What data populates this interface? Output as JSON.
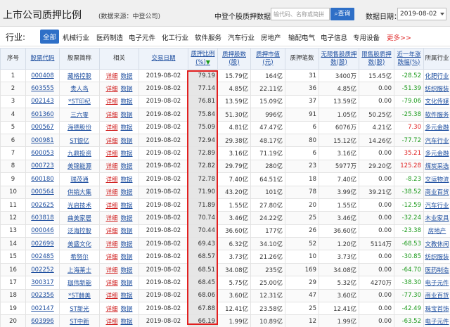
{
  "header": {
    "title": "上市公司质押比例",
    "source": "(数据来源：中登公司)",
    "search_label": "中登个股质押数据：",
    "search_placeholder": "输代码、名称或简拼",
    "search_button": "查询",
    "date_label": "数据日期：",
    "date_value": "2019-08-02"
  },
  "industry": {
    "label": "行业:",
    "items": [
      "全部",
      "机械行业",
      "医药制造",
      "电子元件",
      "化工行业",
      "软件服务",
      "汽车行业",
      "房地产",
      "输配电气",
      "电子信息",
      "专用设备",
      "更多>>"
    ]
  },
  "table": {
    "headers": [
      "序号",
      "股票代码",
      "股票简称",
      "相关",
      "交易日期",
      "质押比例(%)",
      "质押股数(股)",
      "质押市值(元)",
      "质押笔数",
      "无限售股质押数(股)",
      "限售股质押数(股)",
      "近一年涨跌幅(%)",
      "所属行业"
    ],
    "rel_a": "详细",
    "rel_b": "数据",
    "rows": [
      [
        "1",
        "000408",
        "藏格控股",
        "2019-08-02",
        "79.19",
        "15.79亿",
        "164亿",
        "31",
        "3400万",
        "15.45亿",
        "-28.52",
        "化肥行业"
      ],
      [
        "2",
        "603555",
        "贵人鸟",
        "2019-08-02",
        "77.14",
        "4.85亿",
        "22.11亿",
        "36",
        "4.85亿",
        "0.00",
        "-51.39",
        "纺织服装"
      ],
      [
        "3",
        "002143",
        "*ST印纪",
        "2019-08-02",
        "76.81",
        "13.59亿",
        "15.09亿",
        "37",
        "13.59亿",
        "0.00",
        "-79.06",
        "文化传媒"
      ],
      [
        "4",
        "601360",
        "三六零",
        "2019-08-02",
        "75.84",
        "51.30亿",
        "996亿",
        "91",
        "1.05亿",
        "50.25亿",
        "-25.38",
        "软件服务"
      ],
      [
        "5",
        "000567",
        "海德股份",
        "2019-08-02",
        "75.09",
        "4.81亿",
        "47.47亿",
        "6",
        "6076万",
        "4.21亿",
        "7.30",
        "多元金融"
      ],
      [
        "6",
        "000981",
        "ST银亿",
        "2019-08-02",
        "72.94",
        "29.38亿",
        "48.17亿",
        "80",
        "15.12亿",
        "14.26亿",
        "-77.72",
        "汽车行业"
      ],
      [
        "7",
        "600053",
        "九鼎投资",
        "2019-08-02",
        "72.89",
        "3.16亿",
        "71.19亿",
        "6",
        "3.16亿",
        "0.00",
        "35.21",
        "多元金融"
      ],
      [
        "8",
        "000723",
        "美锦能源",
        "2019-08-02",
        "72.82",
        "29.79亿",
        "280亿",
        "23",
        "5977万",
        "29.20亿",
        "125.28",
        "煤炭采选"
      ],
      [
        "9",
        "600180",
        "瑞茂通",
        "2019-08-02",
        "72.78",
        "7.40亿",
        "64.51亿",
        "18",
        "7.40亿",
        "0.00",
        "-8.23",
        "交运物流"
      ],
      [
        "10",
        "000564",
        "供销大集",
        "2019-08-02",
        "71.90",
        "43.20亿",
        "101亿",
        "78",
        "3.99亿",
        "39.21亿",
        "-38.52",
        "商业百货"
      ],
      [
        "11",
        "002625",
        "光启技术",
        "2019-08-02",
        "71.89",
        "1.55亿",
        "27.80亿",
        "20",
        "1.55亿",
        "0.00",
        "-12.59",
        "汽车行业"
      ],
      [
        "12",
        "603818",
        "曲美家居",
        "2019-08-02",
        "70.74",
        "3.46亿",
        "24.22亿",
        "25",
        "3.46亿",
        "0.00",
        "-32.24",
        "木业家具"
      ],
      [
        "13",
        "000046",
        "泛海控股",
        "2019-08-02",
        "70.44",
        "36.60亿",
        "177亿",
        "26",
        "36.60亿",
        "0.00",
        "-23.38",
        "房地产"
      ],
      [
        "14",
        "002699",
        "美盛文化",
        "2019-08-02",
        "69.43",
        "6.32亿",
        "34.10亿",
        "52",
        "1.20亿",
        "5114万",
        "-68.53",
        "文教休闲"
      ],
      [
        "15",
        "002485",
        "希努尔",
        "2019-08-02",
        "68.57",
        "3.73亿",
        "21.26亿",
        "10",
        "3.73亿",
        "0.00",
        "-30.85",
        "纺织服装"
      ],
      [
        "16",
        "002252",
        "上海莱士",
        "2019-08-02",
        "68.51",
        "34.08亿",
        "235亿",
        "169",
        "34.08亿",
        "0.00",
        "-64.70",
        "医药制造"
      ],
      [
        "17",
        "300317",
        "珈伟新能",
        "2019-08-02",
        "68.45",
        "5.75亿",
        "25.00亿",
        "29",
        "5.32亿",
        "4270万",
        "-38.30",
        "电子元件"
      ],
      [
        "18",
        "002356",
        "*ST赫美",
        "2019-08-02",
        "68.06",
        "3.60亿",
        "12.31亿",
        "47",
        "3.60亿",
        "0.00",
        "-77.30",
        "商业百货"
      ],
      [
        "19",
        "002147",
        "ST新光",
        "2019-08-02",
        "67.88",
        "12.41亿",
        "23.58亿",
        "25",
        "12.41亿",
        "0.00",
        "-42.49",
        "珠宝首饰"
      ],
      [
        "20",
        "603996",
        "ST中新",
        "2019-08-02",
        "66.19",
        "1.99亿",
        "10.89亿",
        "12",
        "1.99亿",
        "0.00",
        "-63.52",
        "电子元件"
      ]
    ]
  },
  "colors": {
    "accent": "#2e6fc7",
    "highlight_border": "#e21f1f",
    "negative": "#1a9a1a",
    "positive": "#e02020"
  }
}
